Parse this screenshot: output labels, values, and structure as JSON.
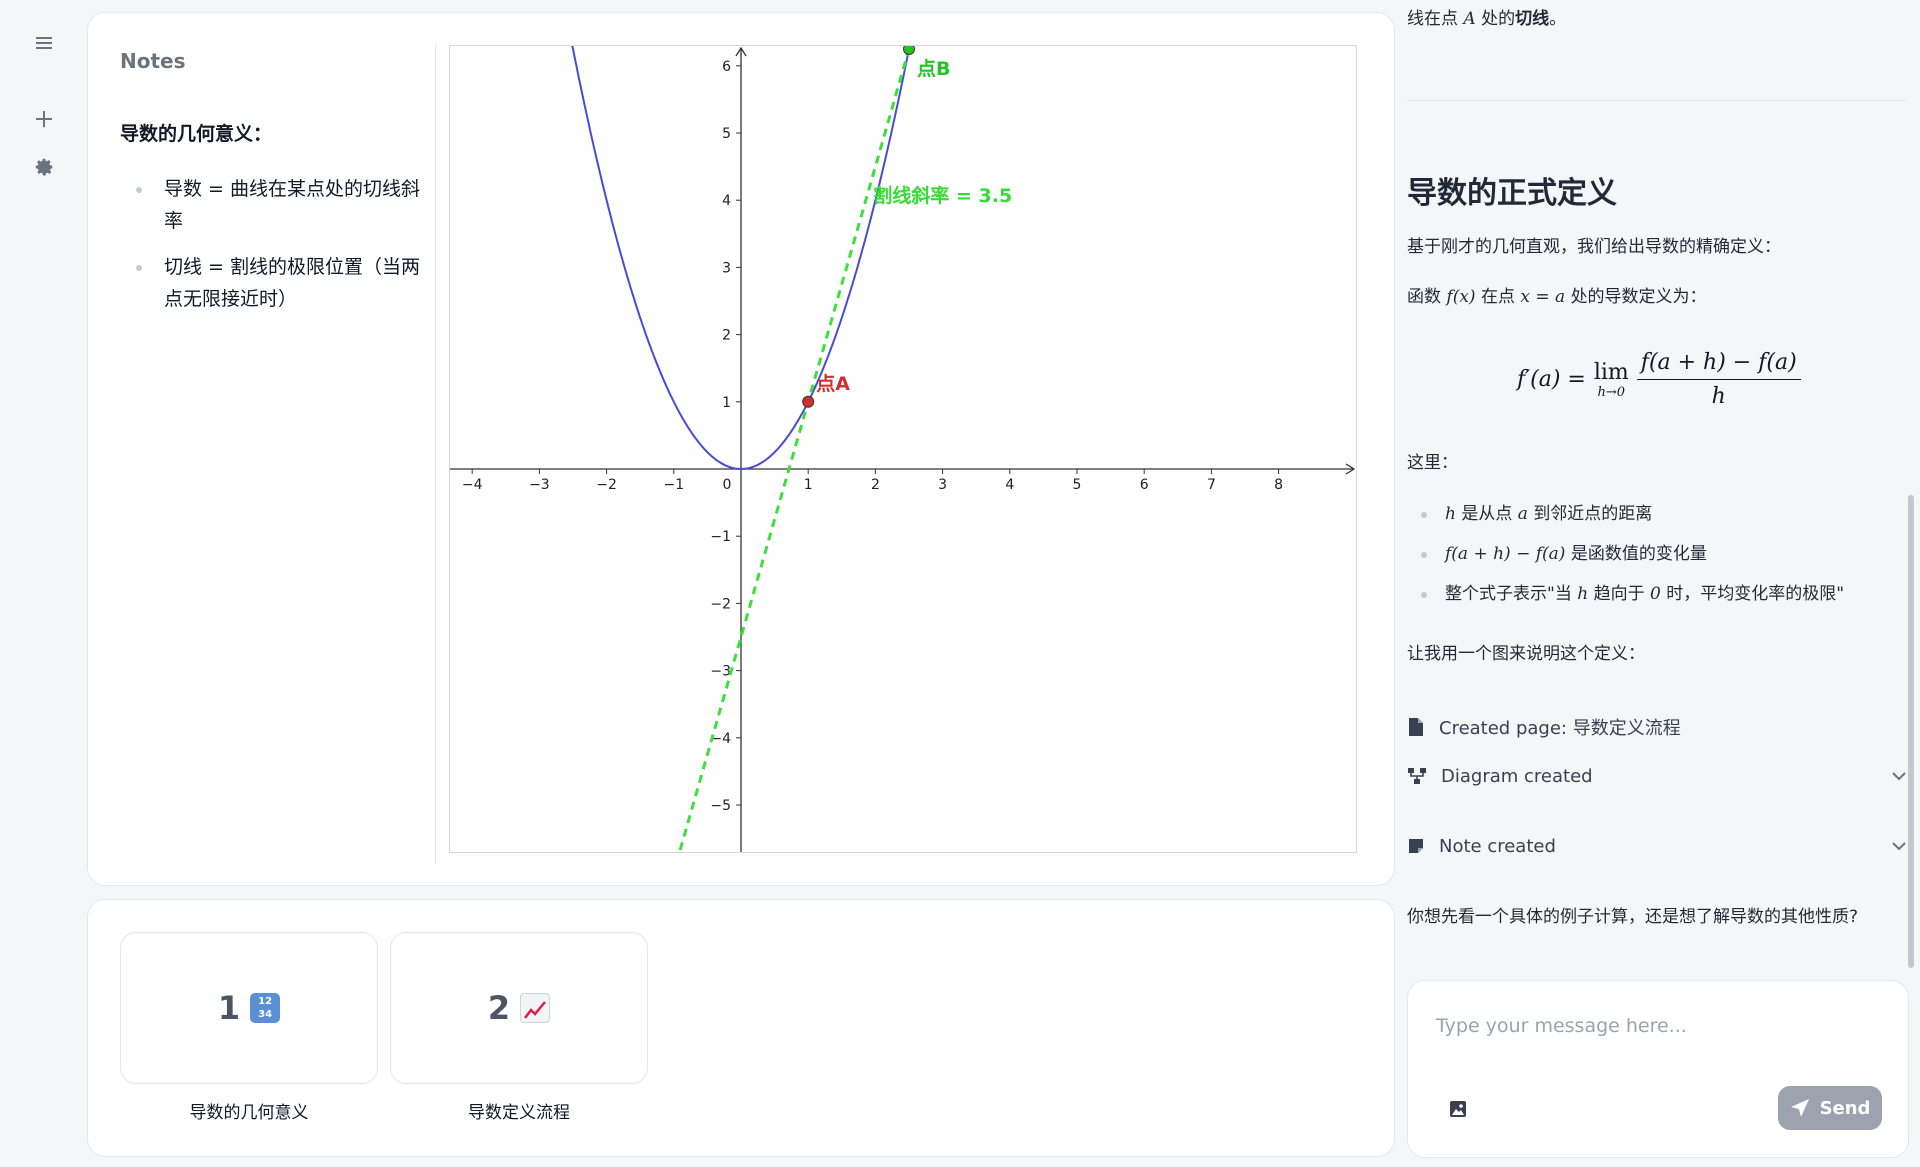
{
  "rail": {
    "icons": [
      "menu-icon",
      "plus-icon",
      "gear-icon"
    ]
  },
  "notes": {
    "title": "Notes",
    "heading": "导数的几何意义：",
    "items": [
      "导数 = 曲线在某点处的切线斜率",
      "切线 = 割线的极限位置（当两点无限接近时）"
    ]
  },
  "chart_data": {
    "type": "line",
    "title": "",
    "xlabel": "",
    "ylabel": "",
    "xlim": [
      -4.3,
      9.1
    ],
    "ylim": [
      -5.8,
      6.3
    ],
    "x_ticks": [
      -4,
      -3,
      -2,
      -1,
      0,
      1,
      2,
      3,
      4,
      5,
      6,
      7,
      8
    ],
    "y_ticks": [
      -5,
      -4,
      -3,
      -2,
      -1,
      1,
      2,
      3,
      4,
      5,
      6
    ],
    "grid": false,
    "series": [
      {
        "function": "y = x^2",
        "color": "#4a4ad8",
        "style": "solid"
      },
      {
        "function": "y = 3.5x - 2.5",
        "color": "#3ce03c",
        "style": "dashed"
      }
    ],
    "points": [
      {
        "name": "点A",
        "x": 1,
        "y": 1,
        "color": "#d32f2f"
      },
      {
        "name": "点B",
        "x": 2.5,
        "y": 6.25,
        "color": "#22c522"
      }
    ],
    "annotations": [
      {
        "text": "割线斜率 = 3.5",
        "x": 2,
        "y": 4,
        "color": "#33dd33"
      }
    ]
  },
  "pages": [
    {
      "number": "1",
      "emoji": "🔢",
      "label": "导数的几何意义"
    },
    {
      "number": "2",
      "emoji": "📈",
      "label": "导数定义流程"
    }
  ],
  "chat": {
    "top_text_pre": "线在点",
    "top_text_var": "A",
    "top_text_mid": "处的",
    "top_text_bold": "切线",
    "top_text_end": "。",
    "heading": "导数的正式定义",
    "intro": "基于刚才的几何直观，我们给出导数的精确定义：",
    "def_pre": "函数",
    "def_func": "f(x)",
    "def_mid": "在点",
    "def_point": "x = a",
    "def_end": "处的导数定义为：",
    "formula_lhs": "f′(a) =",
    "formula_lim": "lim",
    "formula_lim_sub": "h→0",
    "formula_num": "f(a + h) − f(a)",
    "formula_den": "h",
    "here": "这里：",
    "bullets": [
      {
        "math": "h",
        "text": "是从点"
      },
      {
        "math": "f(a + h) − f(a)",
        "text": "是函数值的变化量"
      },
      {
        "math": "",
        "text": "整个式子表示\"当"
      }
    ],
    "bullet1_var": "a",
    "bullet1_end": "到邻近点的距离",
    "bullet3_var1": "h",
    "bullet3_mid": "趋向于",
    "bullet3_var2": "0",
    "bullet3_end": "时，平均变化率的极限\"",
    "diagram_intro": "让我用一个图来说明这个定义：",
    "tool_page": "Created page: 导数定义流程",
    "tool_diagram": "Diagram created",
    "tool_note": "Note created",
    "question": "你想先看一个具体的例子计算，还是想了解导数的其他性质?"
  },
  "input": {
    "placeholder": "Type your message here...",
    "send_label": "Send"
  }
}
